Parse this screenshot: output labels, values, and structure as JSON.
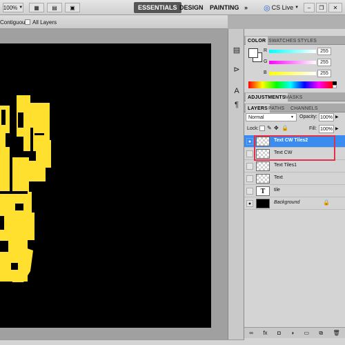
{
  "topbar": {
    "zoom": "100%",
    "workspaces": [
      "ESSENTIALS",
      "DESIGN",
      "PAINTING"
    ],
    "more": "»",
    "cs_live": "CS Live"
  },
  "options": {
    "contiguous": "Contiguous",
    "all_layers": "All Layers"
  },
  "color_panel": {
    "tabs": [
      "COLOR",
      "SWATCHES",
      "STYLES"
    ],
    "channels": [
      {
        "label": "R",
        "value": "255",
        "color": "#ff4b4b"
      },
      {
        "label": "G",
        "value": "255",
        "color": "#3bcf3b"
      },
      {
        "label": "B",
        "value": "255",
        "color": "#4b6bff"
      }
    ]
  },
  "adjust_tabs": [
    "ADJUSTMENTS",
    "MASKS"
  ],
  "layers_panel": {
    "tabs": [
      "LAYERS",
      "PATHS",
      "CHANNELS"
    ],
    "blend_mode": "Normal",
    "opacity_label": "Opacity:",
    "opacity": "100%",
    "lock_label": "Lock:",
    "fill_label": "Fill:",
    "fill": "100%",
    "layers": [
      {
        "name": "Text CW Tiles2",
        "selected": true,
        "visible": true,
        "thumb": "checker"
      },
      {
        "name": "Text CW",
        "selected": false,
        "visible": false,
        "thumb": "checker"
      },
      {
        "name": "Text Tiles1",
        "selected": false,
        "visible": false,
        "thumb": "checker"
      },
      {
        "name": "Text",
        "selected": false,
        "visible": false,
        "thumb": "checker"
      },
      {
        "name": "tile",
        "selected": false,
        "visible": false,
        "thumb": "text"
      },
      {
        "name": "Background",
        "selected": false,
        "visible": true,
        "thumb": "black"
      }
    ]
  },
  "colors": {
    "accent": "#3b8cf0",
    "highlight_border": "#e0304a",
    "shape": "#ffe02e"
  }
}
